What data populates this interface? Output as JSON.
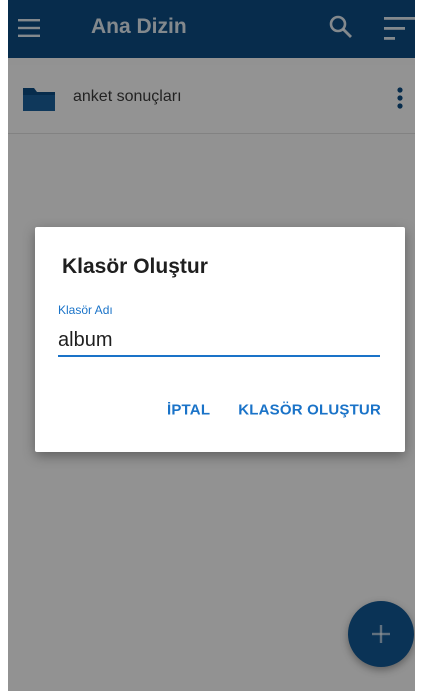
{
  "app_bar": {
    "title": "Ana Dizin",
    "menu_icon": "menu-icon",
    "search_icon": "search-icon",
    "sort_icon": "sort-icon",
    "color": "#0d4a7f"
  },
  "folders": [
    {
      "name": "anket sonuçları",
      "icon": "folder-icon",
      "more_icon": "more-vert-icon"
    }
  ],
  "dialog": {
    "title": "Klasör Oluştur",
    "field_label": "Klasör Adı",
    "field_value": "album",
    "cancel_label": "İPTAL",
    "create_label": "KLASÖR OLUŞTUR",
    "accent_color": "#1a73c8"
  },
  "fab": {
    "icon": "plus-icon",
    "color": "#12558f"
  }
}
